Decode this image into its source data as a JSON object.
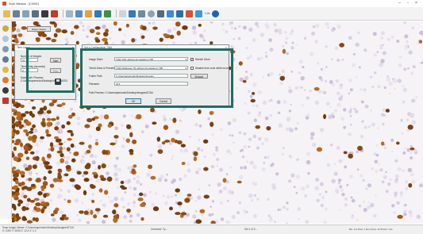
{
  "window": {
    "title": "Scan Window - [C0001]"
  },
  "viewer": {
    "tab_label": "Reset Viewer"
  },
  "toolbar": {
    "buttons": [
      "open-icon",
      "save-icon",
      "snapshot-icon",
      "grid-icon",
      "layers-icon",
      "camera-icon",
      "chart-icon",
      "image-icon",
      "ruler-icon",
      "table-icon",
      "arrow-icon",
      "crosshair-icon",
      "zoom-in-icon",
      "zoom-out-icon",
      "circle-icon",
      "shapes-icon",
      "arrow-right-icon",
      "target-icon",
      "palette-icon",
      "zoom-fit-icon",
      "info-icon"
    ],
    "zoom_label": "1:2x"
  },
  "timelapse_panel": {
    "title": "Time Lapse",
    "images_label": "Number of Images",
    "images_value": "10",
    "start_button": "Start",
    "delay_label": "Time Delay (seconds)",
    "delay_value": "0",
    "stop_button": "Stop",
    "save_path_label": "Save Path: Process: C:\\Users\\aperiodor\\Desktop\\Images\\AT03"
  },
  "timeout_dialog": {
    "title": "Set a Configuration TWA",
    "image_store_label": "Image Store",
    "image_store_value": "TWA TIFF without Annotations (Tiff)",
    "stretch_label": "Stretch Store",
    "format_label": "Timed Zeiss & Presets",
    "format_value": "TWA Multipage TIF without Annotations (Tiff)",
    "disable_label": "Disable time zone while recording",
    "folder_label": "Folder Path",
    "folder_value": "C:\\Users\\aperiodor\\Desktop\\Images",
    "browse_button": "Browse",
    "filename_label": "Filename",
    "filename_value": "AT3",
    "path_preview": "Path Preview: C:\\Users\\aperiodor\\Desktop\\Images\\AT3\\A",
    "ok_button": "OK",
    "cancel_button": "Cancel"
  },
  "status": {
    "left": "Scan Image Viewer: C:\\Users\\aperiodor\\Desktop\\Images\\AT3.tif",
    "coords": "X: 1000  Y: 2000  Z: 12.4  Z: 1.2",
    "mid1": "Unlocked: Ty...",
    "mid2": "Set 1 of 0 ...",
    "right": "Bin: 1x1  Pixel: 1.0um  Zoom: 12.5%  Ex: 1.0s"
  },
  "colors": {
    "teal": "#1e6e63",
    "stain_brown": "#8a4a14"
  }
}
